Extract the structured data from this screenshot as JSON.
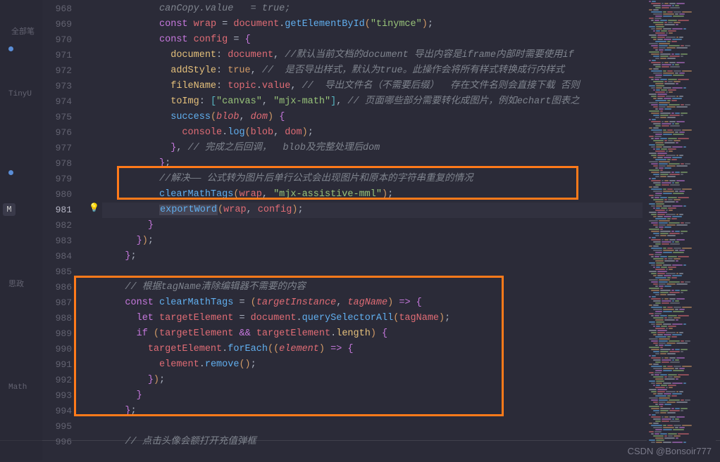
{
  "sidebar": {
    "marker": "M",
    "label_top": "全部笔",
    "ghost_items": [
      "TinyU",
      "思政",
      "Math"
    ]
  },
  "gutter": {
    "start": 968,
    "current": 981
  },
  "lines": {
    "968": {
      "indent": "          ",
      "t": "canCopy.value   = true;"
    },
    "969": {
      "indent": "          ",
      "tokens": [
        [
          "kw",
          "const"
        ],
        [
          "op",
          " "
        ],
        [
          "var",
          "wrap"
        ],
        [
          "op",
          " = "
        ],
        [
          "var",
          "document"
        ],
        [
          "op",
          "."
        ],
        [
          "fn",
          "getElementById"
        ],
        [
          "paren",
          "("
        ],
        [
          "str",
          "\"tinymce\""
        ],
        [
          "paren",
          ")"
        ],
        [
          "op",
          ";"
        ]
      ]
    },
    "970": {
      "indent": "          ",
      "tokens": [
        [
          "kw",
          "const"
        ],
        [
          "op",
          " "
        ],
        [
          "var",
          "config"
        ],
        [
          "op",
          " = "
        ],
        [
          "brace",
          "{"
        ]
      ]
    },
    "971": {
      "indent": "            ",
      "tokens": [
        [
          "prop",
          "document"
        ],
        [
          "op",
          ": "
        ],
        [
          "var",
          "document"
        ],
        [
          "op",
          ", "
        ],
        [
          "cmt",
          "//默认当前文档的document 导出内容是iframe内部时需要使用if"
        ]
      ]
    },
    "972": {
      "indent": "            ",
      "tokens": [
        [
          "prop",
          "addStyle"
        ],
        [
          "op",
          ": "
        ],
        [
          "bool",
          "true"
        ],
        [
          "op",
          ", "
        ],
        [
          "cmt",
          "//  是否导出样式，默认为true。此操作会将所有样式转换成行内样式"
        ]
      ]
    },
    "973": {
      "indent": "            ",
      "tokens": [
        [
          "prop",
          "fileName"
        ],
        [
          "op",
          ": "
        ],
        [
          "var",
          "topic"
        ],
        [
          "op",
          "."
        ],
        [
          "var",
          "value"
        ],
        [
          "op",
          ", "
        ],
        [
          "cmt",
          "//  导出文件名（不需要后缀）  存在文件名则会直接下载 否则"
        ]
      ]
    },
    "974": {
      "indent": "            ",
      "tokens": [
        [
          "prop",
          "toImg"
        ],
        [
          "op",
          ": "
        ],
        [
          "brack",
          "["
        ],
        [
          "str",
          "\"canvas\""
        ],
        [
          "op",
          ", "
        ],
        [
          "str",
          "\"mjx-math\""
        ],
        [
          "brack",
          "]"
        ],
        [
          "op",
          ", "
        ],
        [
          "cmt",
          "// 页面哪些部分需要转化成图片，例如echart图表之"
        ]
      ]
    },
    "975": {
      "indent": "            ",
      "tokens": [
        [
          "fn",
          "success"
        ],
        [
          "paren",
          "("
        ],
        [
          "param",
          "blob"
        ],
        [
          "op",
          ", "
        ],
        [
          "param",
          "dom"
        ],
        [
          "paren",
          ")"
        ],
        [
          "op",
          " "
        ],
        [
          "brace",
          "{"
        ]
      ]
    },
    "976": {
      "indent": "              ",
      "tokens": [
        [
          "var",
          "console"
        ],
        [
          "op",
          "."
        ],
        [
          "fn",
          "log"
        ],
        [
          "paren",
          "("
        ],
        [
          "var",
          "blob"
        ],
        [
          "op",
          ", "
        ],
        [
          "var",
          "dom"
        ],
        [
          "paren",
          ")"
        ],
        [
          "op",
          ";"
        ]
      ]
    },
    "977": {
      "indent": "            ",
      "tokens": [
        [
          "brace",
          "}"
        ],
        [
          "op",
          ", "
        ],
        [
          "cmt",
          "// 完成之后回调，  blob及完整处理后dom"
        ]
      ]
    },
    "978": {
      "indent": "          ",
      "tokens": [
        [
          "brace",
          "}"
        ],
        [
          "op",
          ";"
        ]
      ]
    },
    "979": {
      "indent": "          ",
      "tokens": [
        [
          "cmt",
          "//解决—— 公式转为图片后单行公式会出现图片和原本的字符串重复的情况"
        ]
      ]
    },
    "980": {
      "indent": "          ",
      "tokens": [
        [
          "hl-clear",
          "clearMathTags"
        ],
        [
          "paren",
          "("
        ],
        [
          "var",
          "wrap"
        ],
        [
          "op",
          ", "
        ],
        [
          "str",
          "\"mjx-assistive-mml\""
        ],
        [
          "paren",
          ")"
        ],
        [
          "op",
          ";"
        ]
      ]
    },
    "981": {
      "indent": "          ",
      "tokens": [
        [
          "hl-export",
          "exportWord"
        ],
        [
          "paren",
          "("
        ],
        [
          "var",
          "wrap"
        ],
        [
          "op",
          ", "
        ],
        [
          "var",
          "config"
        ],
        [
          "paren",
          ")"
        ],
        [
          "op",
          ";"
        ]
      ]
    },
    "982": {
      "indent": "        ",
      "tokens": [
        [
          "brace",
          "}"
        ]
      ]
    },
    "983": {
      "indent": "      ",
      "tokens": [
        [
          "brace",
          "}"
        ],
        [
          "paren",
          ")"
        ],
        [
          "op",
          ";"
        ]
      ]
    },
    "984": {
      "indent": "    ",
      "tokens": [
        [
          "brace",
          "}"
        ],
        [
          "op",
          ";"
        ]
      ]
    },
    "985": {
      "indent": "",
      "tokens": []
    },
    "986": {
      "indent": "    ",
      "tokens": [
        [
          "cmt",
          "// 根据tagName清除编辑器不需要的内容"
        ]
      ]
    },
    "987": {
      "indent": "    ",
      "tokens": [
        [
          "kw",
          "const"
        ],
        [
          "op",
          " "
        ],
        [
          "fn",
          "clearMathTags"
        ],
        [
          "op",
          " = "
        ],
        [
          "paren",
          "("
        ],
        [
          "param",
          "targetInstance"
        ],
        [
          "op",
          ", "
        ],
        [
          "param",
          "tagName"
        ],
        [
          "paren",
          ")"
        ],
        [
          "op",
          " "
        ],
        [
          "kw",
          "=>"
        ],
        [
          "op",
          " "
        ],
        [
          "brace",
          "{"
        ]
      ]
    },
    "988": {
      "indent": "      ",
      "tokens": [
        [
          "kw",
          "let"
        ],
        [
          "op",
          " "
        ],
        [
          "var",
          "targetElement"
        ],
        [
          "op",
          " = "
        ],
        [
          "var",
          "document"
        ],
        [
          "op",
          "."
        ],
        [
          "fn",
          "querySelectorAll"
        ],
        [
          "paren",
          "("
        ],
        [
          "var",
          "tagName"
        ],
        [
          "paren",
          ")"
        ],
        [
          "op",
          ";"
        ]
      ]
    },
    "989": {
      "indent": "      ",
      "tokens": [
        [
          "kw",
          "if"
        ],
        [
          "op",
          " "
        ],
        [
          "paren",
          "("
        ],
        [
          "var",
          "targetElement"
        ],
        [
          "op",
          " "
        ],
        [
          "kw",
          "&&"
        ],
        [
          "op",
          " "
        ],
        [
          "var",
          "targetElement"
        ],
        [
          "op",
          "."
        ],
        [
          "prop",
          "length"
        ],
        [
          "paren",
          ")"
        ],
        [
          "op",
          " "
        ],
        [
          "brace",
          "{"
        ]
      ]
    },
    "990": {
      "indent": "        ",
      "tokens": [
        [
          "var",
          "targetElement"
        ],
        [
          "op",
          "."
        ],
        [
          "fn",
          "forEach"
        ],
        [
          "paren",
          "(("
        ],
        [
          "param",
          "element"
        ],
        [
          "paren",
          ")"
        ],
        [
          "op",
          " "
        ],
        [
          "kw",
          "=>"
        ],
        [
          "op",
          " "
        ],
        [
          "brace",
          "{"
        ]
      ]
    },
    "991": {
      "indent": "          ",
      "tokens": [
        [
          "var",
          "element"
        ],
        [
          "op",
          "."
        ],
        [
          "fn",
          "remove"
        ],
        [
          "paren",
          "()"
        ],
        [
          "op",
          ";"
        ]
      ]
    },
    "992": {
      "indent": "        ",
      "tokens": [
        [
          "brace",
          "}"
        ],
        [
          "paren",
          ")"
        ],
        [
          "op",
          ";"
        ]
      ]
    },
    "993": {
      "indent": "      ",
      "tokens": [
        [
          "brace",
          "}"
        ]
      ]
    },
    "994": {
      "indent": "    ",
      "tokens": [
        [
          "brace",
          "}"
        ],
        [
          "op",
          ";"
        ]
      ]
    },
    "995": {
      "indent": "",
      "tokens": []
    },
    "996": {
      "indent": "    ",
      "tokens": [
        [
          "cmt",
          "// 点击头像会额打开充值弹框"
        ]
      ]
    }
  },
  "watermark": "CSDN @Bonsoir777",
  "chart_data": null
}
